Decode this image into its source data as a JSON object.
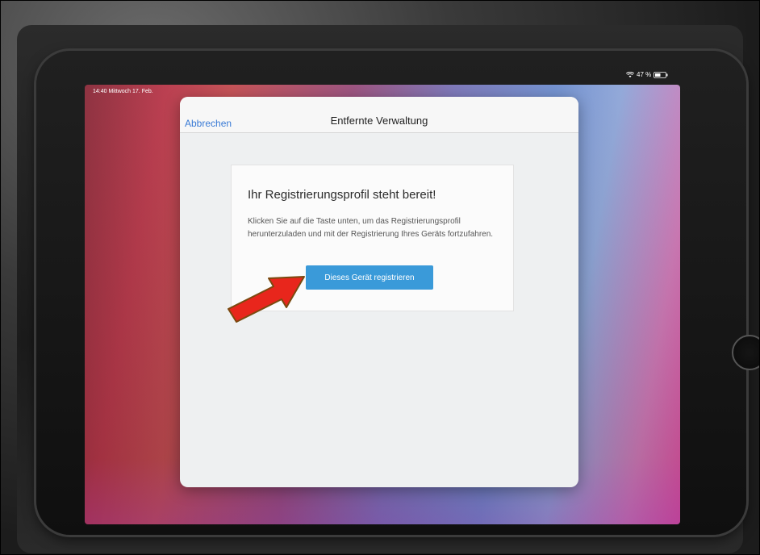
{
  "status_bar": {
    "time_date": "14:40  Mittwoch 17. Feb.",
    "battery": "47 %",
    "wifi_icon": "wifi-icon",
    "battery_icon": "battery-icon"
  },
  "modal": {
    "cancel_label": "Abbrechen",
    "title": "Entfernte Verwaltung"
  },
  "card": {
    "heading": "Ihr Registrierungsprofil steht bereit!",
    "text": "Klicken Sie auf die Taste unten, um das Registrierungsprofil herunterzuladen und mit der Registrierung Ihres Geräts fortzufahren.",
    "button_label": "Dieses Gerät registrieren"
  },
  "colors": {
    "accent_button": "#3a9ad9",
    "link": "#3a7bd5",
    "annotation_arrow": "#e8261c"
  }
}
